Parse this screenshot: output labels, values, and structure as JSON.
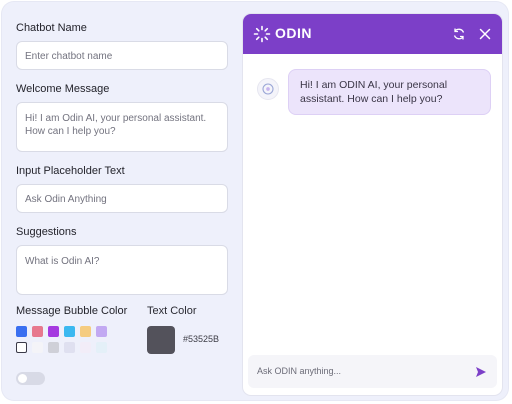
{
  "settings": {
    "chatbot_name_label": "Chatbot Name",
    "chatbot_name_placeholder": "Enter chatbot name",
    "welcome_label": "Welcome Message",
    "welcome_value": "Hi! I am Odin AI, your personal assistant. How can I help you?",
    "placeholder_label": "Input Placeholder Text",
    "placeholder_value": "Ask Odin Anything",
    "suggestions_label": "Suggestions",
    "suggestions_value": "What is Odin AI?",
    "bubble_color_label": "Message Bubble Color",
    "text_color_label": "Text Color",
    "text_color_hex": "#53525B",
    "swatch_colors": [
      "#3a6ff0",
      "#e7788e",
      "#a53ae0",
      "#3bb8f0",
      "#f5cc80",
      "#c2a9f2",
      "#ffffff",
      "#f4f4f8",
      "#cfd0d8",
      "#dfe0f0",
      "#f2edf8",
      "#e4f0f8"
    ]
  },
  "chat": {
    "brand": "ODIN",
    "welcome_message": "Hi! I am ODIN AI, your personal assistant. How can I help you?",
    "input_placeholder": "Ask ODIN anything...",
    "header_color": "#7c3fc8"
  }
}
